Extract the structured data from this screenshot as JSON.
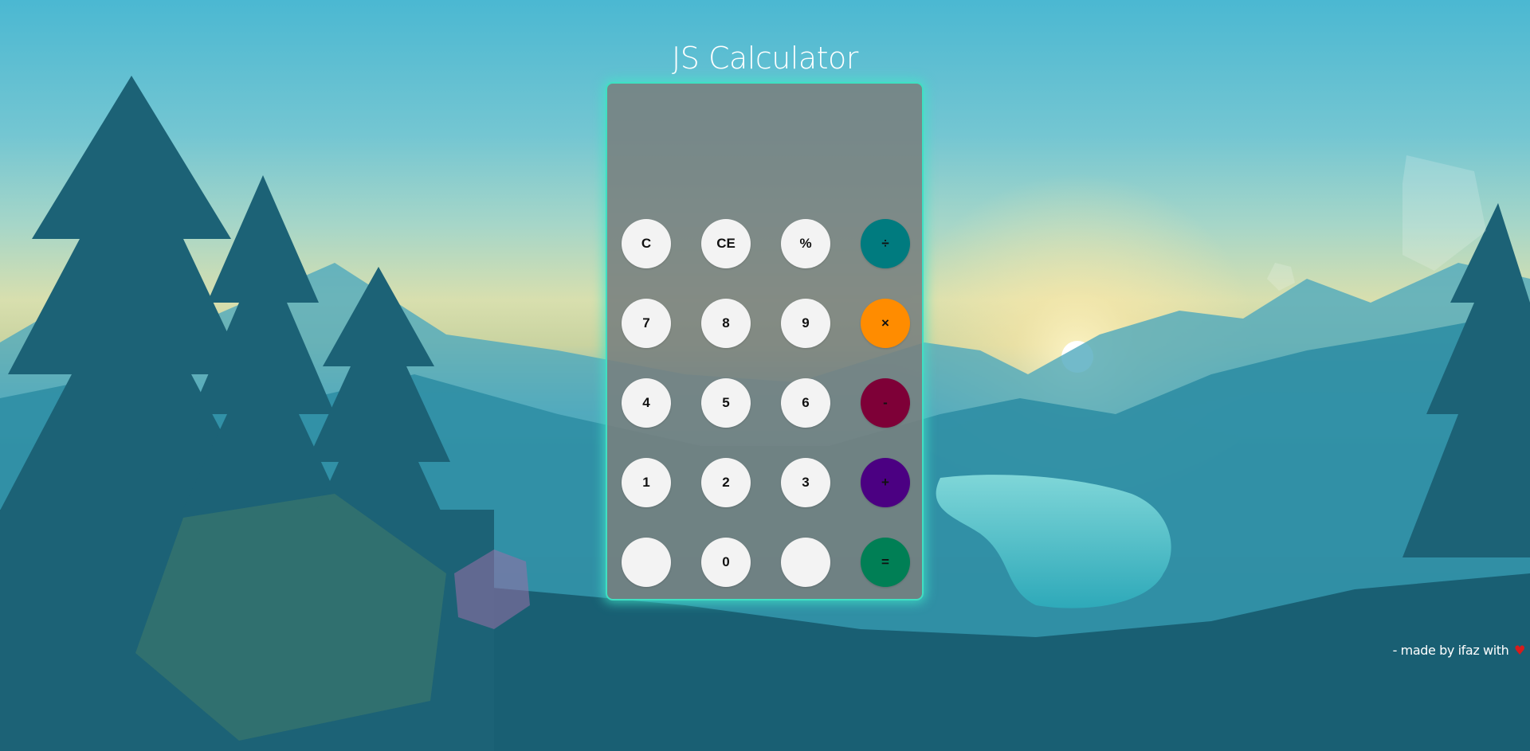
{
  "header": {
    "title": "JS Calculator"
  },
  "display": {
    "value": ""
  },
  "keys": [
    {
      "label": "C",
      "name": "clear-button",
      "color": "#f3f3f3",
      "text_color": "#111111"
    },
    {
      "label": "CE",
      "name": "clear-entry-button",
      "color": "#f3f3f3",
      "text_color": "#111111"
    },
    {
      "label": "%",
      "name": "percent-button",
      "color": "#f3f3f3",
      "text_color": "#111111"
    },
    {
      "label": "÷",
      "name": "divide-button",
      "color": "#007b7f",
      "text_color": "#111111"
    },
    {
      "label": "7",
      "name": "digit-7-button",
      "color": "#f3f3f3",
      "text_color": "#111111"
    },
    {
      "label": "8",
      "name": "digit-8-button",
      "color": "#f3f3f3",
      "text_color": "#111111"
    },
    {
      "label": "9",
      "name": "digit-9-button",
      "color": "#f3f3f3",
      "text_color": "#111111"
    },
    {
      "label": "×",
      "name": "multiply-button",
      "color": "#ff8c00",
      "text_color": "#111111"
    },
    {
      "label": "4",
      "name": "digit-4-button",
      "color": "#f3f3f3",
      "text_color": "#111111"
    },
    {
      "label": "5",
      "name": "digit-5-button",
      "color": "#f3f3f3",
      "text_color": "#111111"
    },
    {
      "label": "6",
      "name": "digit-6-button",
      "color": "#f3f3f3",
      "text_color": "#111111"
    },
    {
      "label": "-",
      "name": "subtract-button",
      "color": "#7e0037",
      "text_color": "#111111"
    },
    {
      "label": "1",
      "name": "digit-1-button",
      "color": "#f3f3f3",
      "text_color": "#111111"
    },
    {
      "label": "2",
      "name": "digit-2-button",
      "color": "#f3f3f3",
      "text_color": "#111111"
    },
    {
      "label": "3",
      "name": "digit-3-button",
      "color": "#f3f3f3",
      "text_color": "#111111"
    },
    {
      "label": "+",
      "name": "add-button",
      "color": "#4b0082",
      "text_color": "#111111"
    },
    {
      "label": "",
      "name": "blank-left-button",
      "color": "#f3f3f3",
      "text_color": "#111111"
    },
    {
      "label": "0",
      "name": "digit-0-button",
      "color": "#f3f3f3",
      "text_color": "#111111"
    },
    {
      "label": "",
      "name": "blank-right-button",
      "color": "#f3f3f3",
      "text_color": "#111111"
    },
    {
      "label": "=",
      "name": "equals-button",
      "color": "#007f55",
      "text_color": "#111111"
    }
  ],
  "footer": {
    "text": "- made by ifaz with",
    "icon": "heart-icon",
    "heart_glyph": "♥",
    "heart_color": "#d81b1b"
  },
  "theme": {
    "glow_color": "#3fe0c3"
  }
}
